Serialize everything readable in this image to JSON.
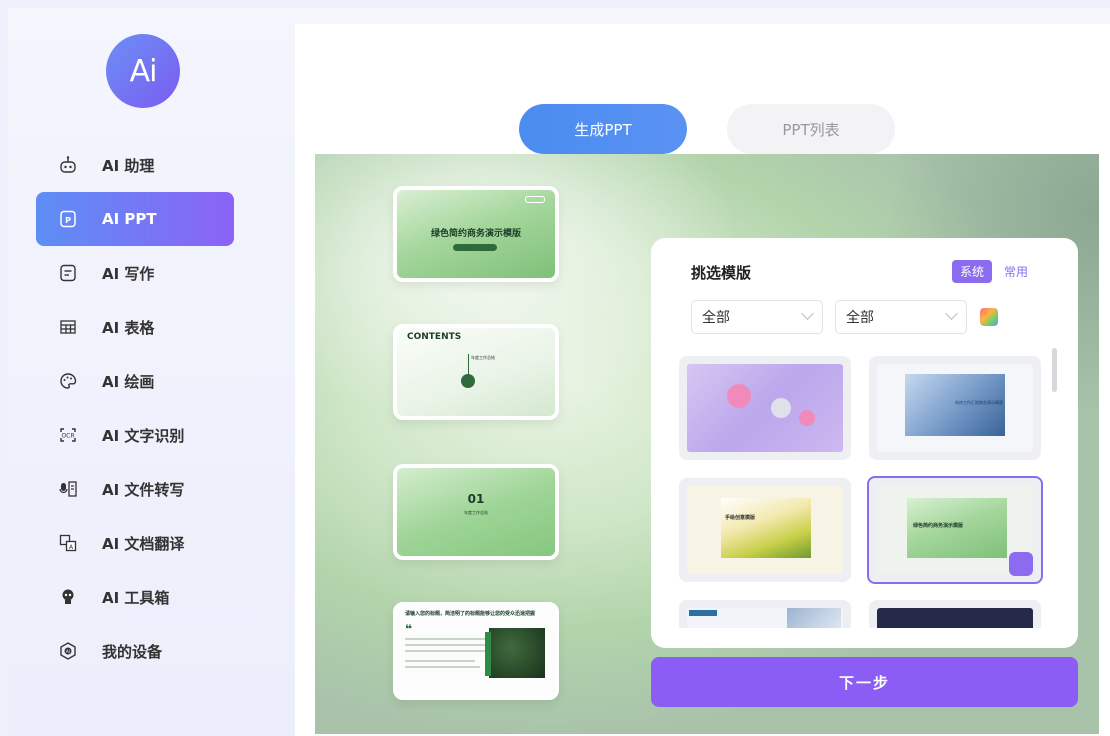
{
  "logo": {
    "text": "Ai"
  },
  "sidebar": {
    "items": [
      {
        "label": "AI 助理",
        "icon": "robot-icon"
      },
      {
        "label": "AI PPT",
        "icon": "ppt-file-icon"
      },
      {
        "label": "AI 写作",
        "icon": "document-icon"
      },
      {
        "label": "AI 表格",
        "icon": "table-icon"
      },
      {
        "label": "AI 绘画",
        "icon": "palette-icon"
      },
      {
        "label": "AI 文字识别",
        "icon": "ocr-icon"
      },
      {
        "label": "AI 文件转写",
        "icon": "transcribe-icon"
      },
      {
        "label": "AI 文档翻译",
        "icon": "translate-icon"
      },
      {
        "label": "AI 工具箱",
        "icon": "toolbox-icon"
      },
      {
        "label": "我的设备",
        "icon": "device-icon"
      }
    ],
    "active_index": 1
  },
  "tabs": {
    "generate": "生成PPT",
    "list": "PPT列表"
  },
  "slides": {
    "s1_title": "绿色简约商务演示模版",
    "s2_title": "CONTENTS",
    "s2_item": "年度工作总结",
    "s3_number": "01",
    "s3_sub": "年度工作总结",
    "s4_title": "请输入您的标题，简洁明了的标题能够让您的受众迅速把握"
  },
  "template_panel": {
    "title": "挑选模版",
    "toggle": {
      "system": "系统",
      "common": "常用"
    },
    "filter1": "全部",
    "filter2": "全部",
    "template_labels": {
      "t2": "年终工作汇报商务演示模版",
      "t3": "手绘创意模版",
      "t4": "绿色简约商务演示模版"
    }
  },
  "next_button": "下一步",
  "colors": {
    "accent": "#8b5df5",
    "tab_blue": "#4a8cf0"
  }
}
